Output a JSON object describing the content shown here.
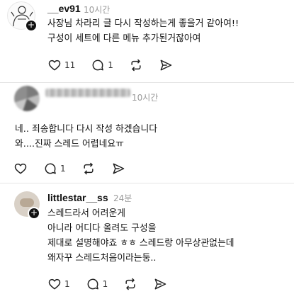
{
  "posts": [
    {
      "username": "__ev91",
      "time": "10시간",
      "lines": [
        "사장님 차라리 글 다시 작성하는게 좋을거 같아여!!",
        "구성이 세트에 다른 메뉴 추가된거잖아여"
      ],
      "likes": "11",
      "comments": "1"
    },
    {
      "username": "",
      "time": "10시간",
      "lines": [
        "네.. 죄송합니다 다시 작성 하겠습니다",
        "와....진짜 스레드 어렵네요ㅠ"
      ],
      "likes": "",
      "comments": "1"
    },
    {
      "username": "littlestar__ss",
      "time": "24분",
      "lines": [
        "스레드라서 어려운게",
        "아니라 어디다 올려도 구성을",
        "제대로 설명해야죠 ㅎㅎ 스레드랑 아무상관없는데",
        "왜자꾸 스레드처음이라는둥.."
      ],
      "likes": "1",
      "comments": "1"
    }
  ],
  "icons": {
    "like": "heart-icon",
    "comment": "comment-icon",
    "repost": "repost-icon",
    "share": "share-icon",
    "follow": "plus-icon"
  },
  "colors": {
    "text": "#111111",
    "muted": "#9a9a9a",
    "divider": "#e5e5e5"
  }
}
